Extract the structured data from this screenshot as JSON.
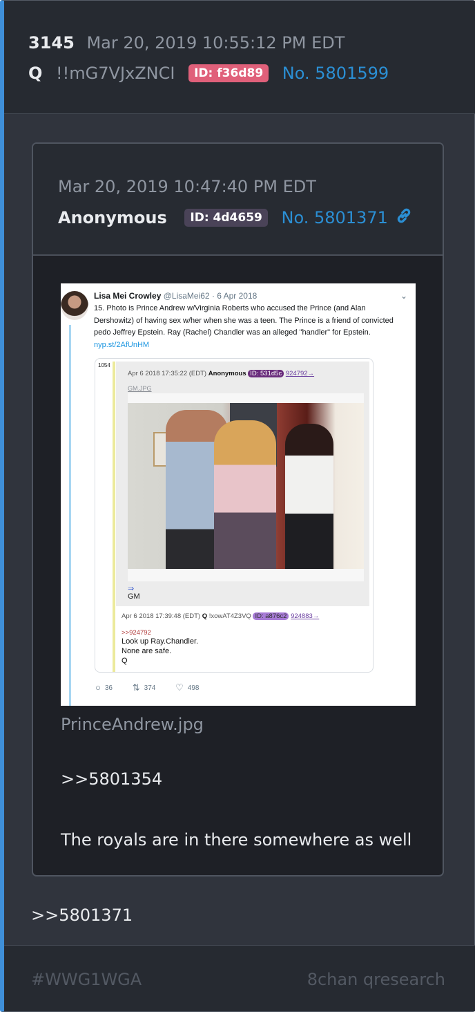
{
  "post": {
    "number": "3145",
    "date": "Mar 20, 2019 10:55:12 PM EDT",
    "author": "Q",
    "tripcode": "!!mG7VJxZNCI",
    "id_label": "ID: f36d89",
    "post_link": "No. 5801599",
    "id_color": "#e0607a"
  },
  "quoted_post": {
    "date": "Mar 20, 2019 10:47:40 PM EDT",
    "author": "Anonymous",
    "id_label": "ID: 4d4659",
    "post_link": "No. 5801371",
    "link_icon": "link-icon",
    "id_color": "#4a4358",
    "tweet": {
      "name": "Lisa Mei Crowley",
      "handle": "@LisaMei62",
      "date": "· 6 Apr 2018",
      "text": "15. Photo is Prince Andrew w/Virginia Roberts who accused the Prince (and Alan Dershowitz) of having sex w/her when she was a teen. The Prince is a friend of convicted pedo Jeffrey Epstein. Ray (Rachel) Chandler was an alleged \"handler\" for Epstein.",
      "link": "nyp.st/2AfUnHM",
      "embed": {
        "number": "1054",
        "meta_date": "Apr 6 2018 17:35:22 (EDT)",
        "meta_author": "Anonymous",
        "meta_id": "ID: 531d5c",
        "meta_link": "924792→",
        "file": "GM.JPG",
        "arrow": "⇒",
        "caption": "GM",
        "reply_date": "Apr 6 2018 17:39:48 (EDT)",
        "reply_author": "Q",
        "reply_trip": "!xowAT4Z3VQ",
        "reply_id": "ID: a876c2",
        "reply_link": "924883→",
        "reply_quote": ">>924792",
        "reply_line1": "Look up Ray.Chandler.",
        "reply_line2": "None are safe.",
        "reply_line3": "Q"
      },
      "replies": "36",
      "retweets": "374",
      "likes": "498"
    },
    "filename": "PrinceAndrew.jpg",
    "reply_ref": ">>5801354",
    "text": "The royals are in there somewhere as well"
  },
  "reply_ref": ">>5801371",
  "footer": {
    "tag": "#WWG1WGA",
    "source": "8chan qresearch"
  }
}
